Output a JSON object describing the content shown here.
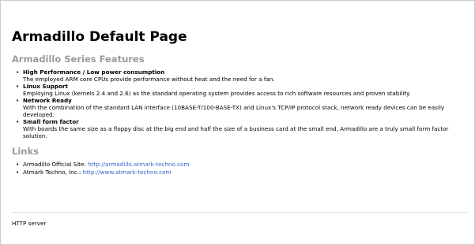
{
  "page": {
    "title": "Armadillo Default Page"
  },
  "features": {
    "heading": "Armadillo Series Features",
    "items": [
      {
        "title": "High Performance / Low power consumption",
        "description": "The employed ARM core CPUs provide performance without heat and the need for a fan."
      },
      {
        "title": "Linux Support",
        "description": "Employing Linux (kernels 2.4 and 2.6) as the standard operating system provides access to rich software resources and proven stability."
      },
      {
        "title": "Network Ready",
        "description": "With the combination of the standard LAN interface (10BASE-T/100-BASE-TX) and Linux's TCP/IP protocol stack, network ready devices can be easily developed."
      },
      {
        "title": "Small form factor",
        "description": "With boards the same size as a floppy disc at the big end and half the size of a business card at the small end, Armadillo are a truly small form factor solution."
      }
    ]
  },
  "links": {
    "heading": "Links",
    "items": [
      {
        "label": "Armadillo Official Site: ",
        "url": "http://armadillo.atmark-techno.com"
      },
      {
        "label": "Atmark Techno, Inc.: ",
        "url": "http://www.atmark-techno.com"
      }
    ]
  },
  "footer": {
    "text": "HTTP server"
  },
  "colors": {
    "heading_gray": "#999999",
    "link_blue": "#3366cc",
    "rule_gray": "#dddddd"
  }
}
